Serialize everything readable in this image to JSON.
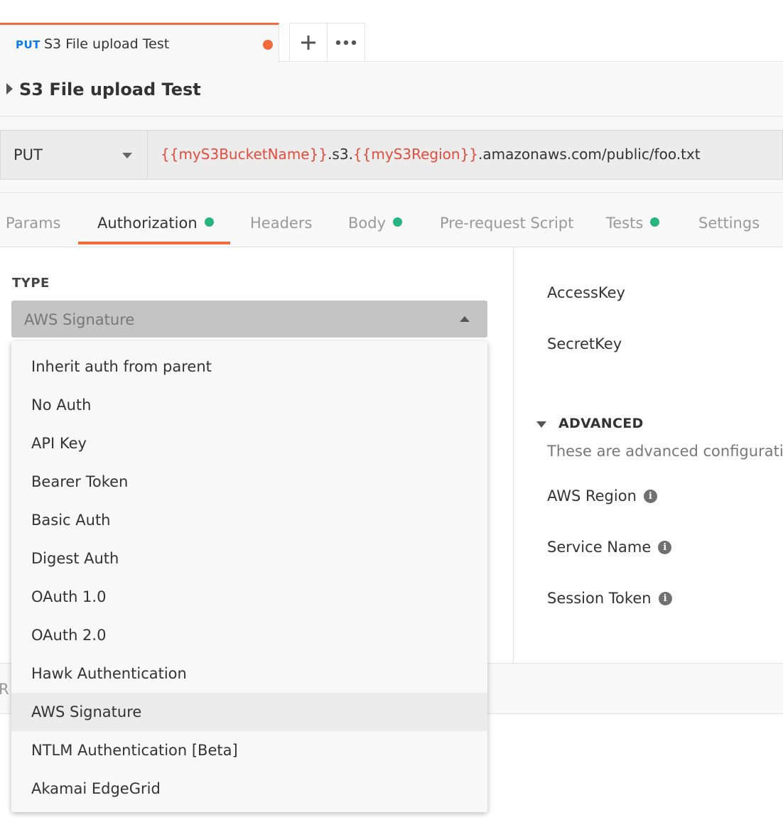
{
  "tab": {
    "method": "PUT",
    "name": "S3 File upload Test",
    "unsaved_color": "#f26b3a"
  },
  "tab_actions": {
    "add_icon": "plus-icon",
    "more_icon": "ellipsis-icon"
  },
  "request": {
    "title": "S3 File upload Test",
    "method": "PUT",
    "url_parts": {
      "var1": "{{myS3BucketName}}",
      "mid": ".s3.",
      "var2": "{{myS3Region}}",
      "rest": ".amazonaws.com/public/foo.txt"
    }
  },
  "subtabs": [
    {
      "label": "Params"
    },
    {
      "label": "Authorization"
    },
    {
      "label": "Headers"
    },
    {
      "label": "Body"
    },
    {
      "label": "Pre-request Script"
    },
    {
      "label": "Tests"
    },
    {
      "label": "Settings"
    }
  ],
  "auth": {
    "type_label": "TYPE",
    "selected_type": "AWS Signature",
    "fields": {
      "access_key": "AccessKey",
      "secret_key": "SecretKey"
    },
    "advanced": {
      "title": "ADVANCED",
      "description": "These are advanced configuration",
      "aws_region": "AWS Region",
      "service_name": "Service Name",
      "session_token": "Session Token"
    }
  },
  "menu": {
    "items": [
      "Inherit auth from parent",
      "No Auth",
      "API Key",
      "Bearer Token",
      "Basic Auth",
      "Digest Auth",
      "OAuth 1.0",
      "OAuth 2.0",
      "Hawk Authentication",
      "AWS Signature",
      "NTLM Authentication [Beta]",
      "Akamai EdgeGrid"
    ],
    "selected": "AWS Signature"
  },
  "response": {
    "label": "R"
  },
  "colors": {
    "accent": "#f26b3a",
    "status_green": "#26b47f",
    "variable_red": "#e54c3c",
    "method_blue": "#097bed"
  }
}
